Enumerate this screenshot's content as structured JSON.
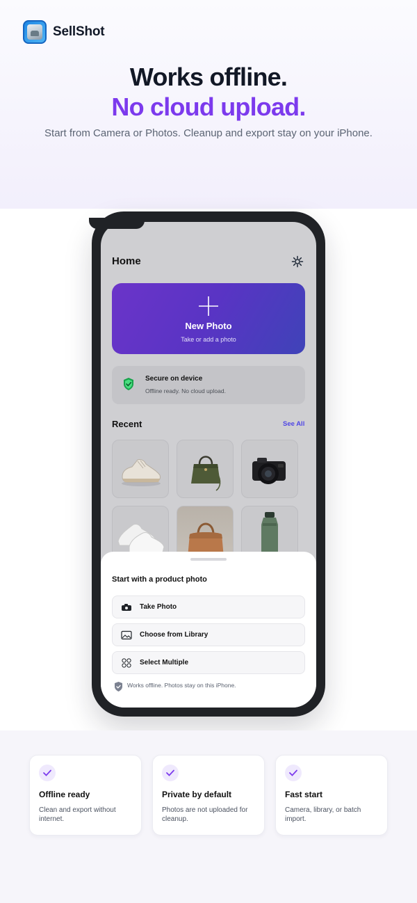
{
  "brand": {
    "name": "SellShot",
    "icon": "app-photo-icon"
  },
  "hero": {
    "title_line1": "Works offline.",
    "title_line2": "No cloud upload.",
    "subtitle": "Start from Camera or Photos. Cleanup and export stay on your iPhone."
  },
  "phone": {
    "home_title": "Home",
    "settings_icon": "gear-icon",
    "new_photo": {
      "label": "New Photo",
      "sublabel": "Take or add a photo",
      "icon": "plus-icon"
    },
    "secure": {
      "title": "Secure on device",
      "subtitle": "Offline ready. No cloud upload.",
      "icon": "shield-check-icon"
    },
    "recent": {
      "title": "Recent",
      "see_all": "See All",
      "items": [
        {
          "name": "sneaker",
          "icon": "sneaker-thumbnail"
        },
        {
          "name": "green-handbag",
          "icon": "handbag-thumbnail"
        },
        {
          "name": "camera",
          "icon": "camera-thumbnail"
        },
        {
          "name": "white-sneakers",
          "icon": "sneakers-thumbnail"
        },
        {
          "name": "tan-handbag",
          "icon": "handbag-thumbnail"
        },
        {
          "name": "water-bottle",
          "icon": "bottle-thumbnail"
        }
      ]
    },
    "sheet": {
      "title": "Start with a product photo",
      "options": [
        {
          "label": "Take Photo",
          "icon": "camera-icon"
        },
        {
          "label": "Choose from Library",
          "icon": "image-icon"
        },
        {
          "label": "Select Multiple",
          "icon": "grid-icon"
        }
      ],
      "note": "Works offline. Photos stay on this iPhone.",
      "note_icon": "shield-check-icon"
    }
  },
  "features": [
    {
      "title": "Offline ready",
      "text": "Clean and export without internet.",
      "icon": "check-icon"
    },
    {
      "title": "Private by default",
      "text": "Photos are not uploaded for cleanup.",
      "icon": "check-icon"
    },
    {
      "title": "Fast start",
      "text": "Camera, library, or batch import.",
      "icon": "check-icon"
    }
  ],
  "colors": {
    "accent": "#7c3aed",
    "link": "#4f46e5",
    "secure_green": "#16a34a"
  }
}
